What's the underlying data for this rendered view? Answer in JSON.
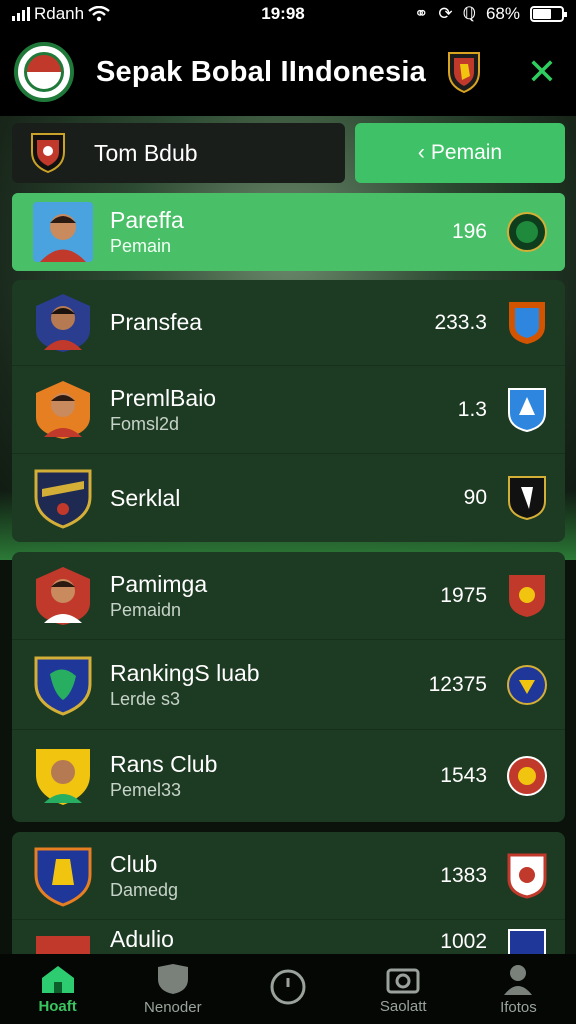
{
  "status": {
    "carrier": "Rdanh",
    "time": "19:98",
    "battery": "68%"
  },
  "header": {
    "title": "Sepak Bobal IIndonesia"
  },
  "toprow": {
    "team": "Tom Bdub",
    "button": "Pemain"
  },
  "highlight": {
    "name": "Pareffa",
    "sub": "Pemain",
    "value": "196"
  },
  "group1": [
    {
      "name": "Pransfea",
      "sub": "",
      "value": "233.3"
    },
    {
      "name": "PremlBaio",
      "sub": "Fomsl2d",
      "value": "1.3"
    },
    {
      "name": "Serklal",
      "sub": "",
      "value": "90"
    }
  ],
  "group2": [
    {
      "name": "Pamimga",
      "sub": "Pemaidn",
      "value": "1975"
    },
    {
      "name": "RankingS luab",
      "sub": "Lerde s3",
      "value": "12375"
    },
    {
      "name": "Rans Club",
      "sub": "Pemel33",
      "value": "1543"
    }
  ],
  "group3": [
    {
      "name": "Club",
      "sub": "Damedg",
      "value": "1383"
    },
    {
      "name": "Adulio",
      "sub": "",
      "value": "1002"
    }
  ],
  "nav": [
    {
      "label": "Hoaft",
      "icon": "home-icon"
    },
    {
      "label": "Nenoder",
      "icon": "shield-icon"
    },
    {
      "label": "",
      "icon": "clock-icon"
    },
    {
      "label": "Saolatt",
      "icon": "camera-icon"
    },
    {
      "label": "Ifotos",
      "icon": "profile-icon"
    }
  ],
  "colors": {
    "accent": "#3fc167",
    "card": "#1d3a23",
    "close": "#2fce60"
  }
}
